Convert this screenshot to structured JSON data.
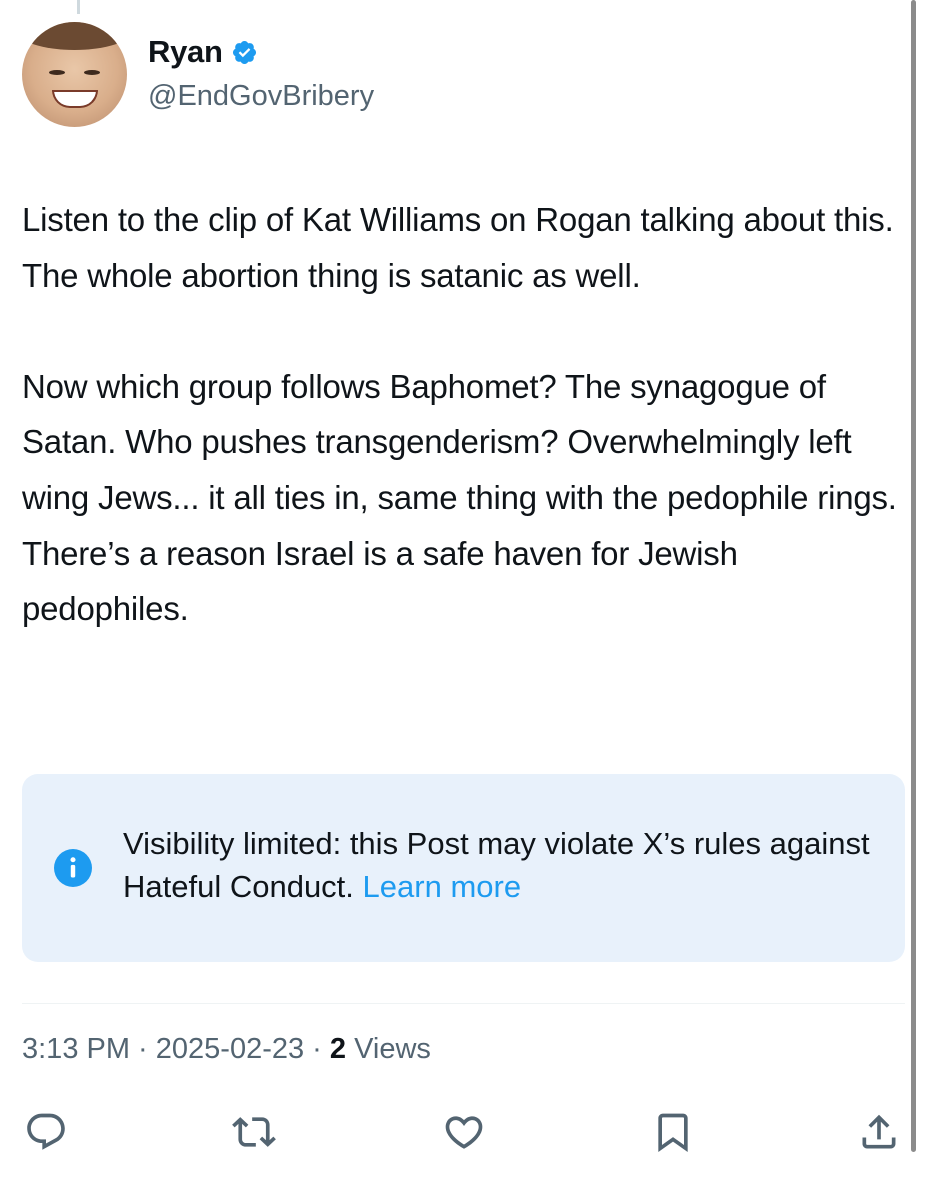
{
  "author": {
    "display_name": "Ryan",
    "handle": "@EndGovBribery",
    "verified": true
  },
  "post": {
    "text": "Listen to the clip of Kat Williams on Rogan talking about this. The whole abortion thing is satanic as well.\n\nNow which group follows Baphomet? The synagogue of Satan. Who pushes transgenderism? Overwhelmingly left wing Jews... it all ties in, same thing with the pedophile rings. There’s a reason Israel is a safe haven for Jewish pedophiles."
  },
  "notice": {
    "text": "Visibility limited: this Post may violate X’s rules against Hateful Conduct.",
    "link": "Learn more",
    "icon": "info-icon"
  },
  "meta": {
    "time": "3:13 PM",
    "sep1": " · ",
    "date": "2025-02-23",
    "sep2": " · ",
    "views_count": "2",
    "views_label": " Views"
  },
  "actions": [
    {
      "icon": "reply-icon"
    },
    {
      "icon": "repost-icon"
    },
    {
      "icon": "like-icon"
    },
    {
      "icon": "bookmark-icon"
    },
    {
      "icon": "share-icon"
    }
  ],
  "colors": {
    "text": "#0f1419",
    "secondary": "#536471",
    "link": "#1d9bf0",
    "notice_bg": "#e8f1fb"
  }
}
